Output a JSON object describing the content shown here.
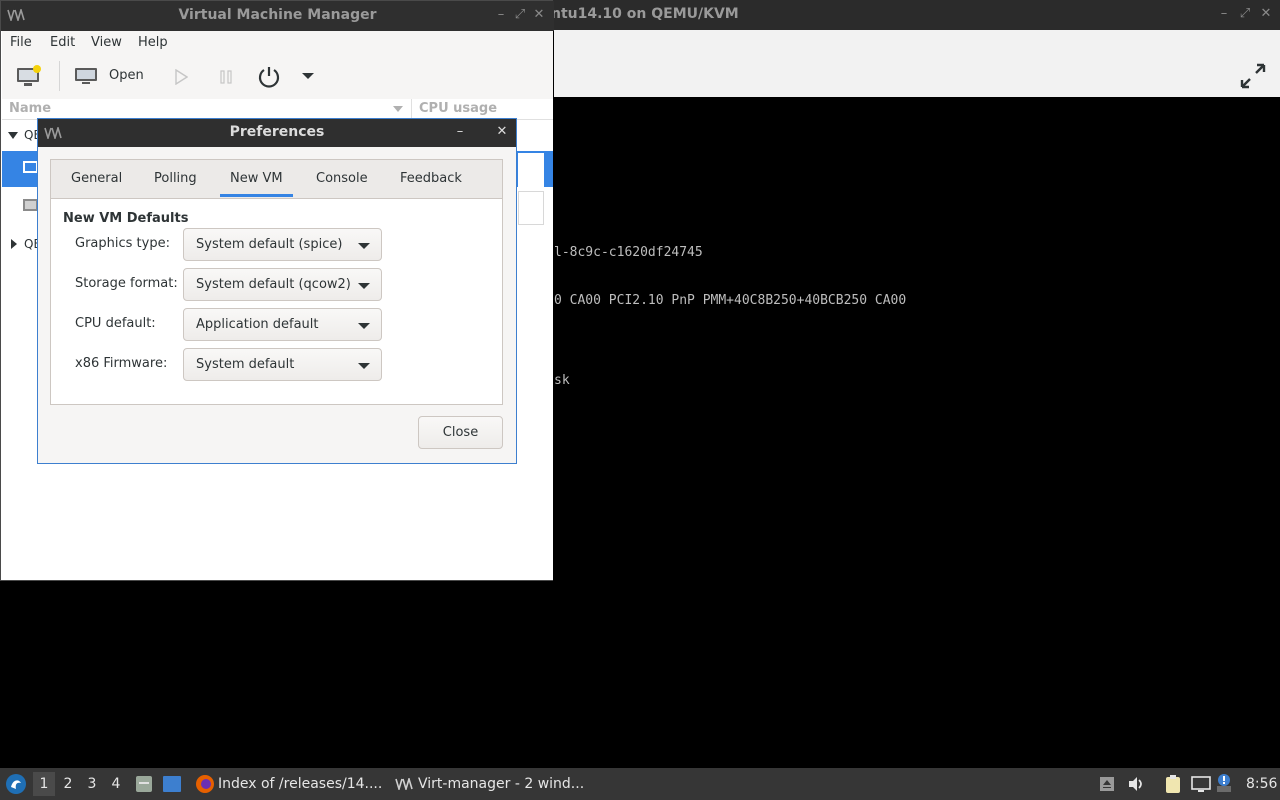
{
  "console_window": {
    "title": "ntu14.10 on QEMU/KVM",
    "screen_lines": [
      "l-8c9c-c1620df24745",
      "0 CA00 PCI2.10 PnP PMM+40C8B250+40BCB250 CA00",
      "sk"
    ]
  },
  "vmm": {
    "title": "Virtual Machine Manager",
    "menu": [
      "File",
      "Edit",
      "View",
      "Help"
    ],
    "toolbar": {
      "open_label": "Open"
    },
    "columns": {
      "name": "Name",
      "cpu": "CPU usage"
    },
    "list": {
      "row1_prefix": "QE",
      "row2_prefix": "QE"
    }
  },
  "prefs": {
    "title": "Preferences",
    "tabs": [
      "General",
      "Polling",
      "New VM",
      "Console",
      "Feedback"
    ],
    "active_tab": "New VM",
    "section_title": "New VM Defaults",
    "rows": [
      {
        "label": "Graphics type:",
        "value": "System default (spice)"
      },
      {
        "label": "Storage format:",
        "value": "System default (qcow2)"
      },
      {
        "label": "CPU default:",
        "value": "Application default"
      },
      {
        "label": "x86 Firmware:",
        "value": "System default"
      }
    ],
    "close_label": "Close"
  },
  "taskbar": {
    "workspaces": [
      "1",
      "2",
      "3",
      "4"
    ],
    "tasks": [
      "Index of /releases/14....",
      "Virt-manager - 2 wind..."
    ],
    "clock": "8:56"
  },
  "colors": {
    "accent": "#3584e4",
    "titlebar": "#2f2f2f",
    "taskbar": "#363636"
  }
}
